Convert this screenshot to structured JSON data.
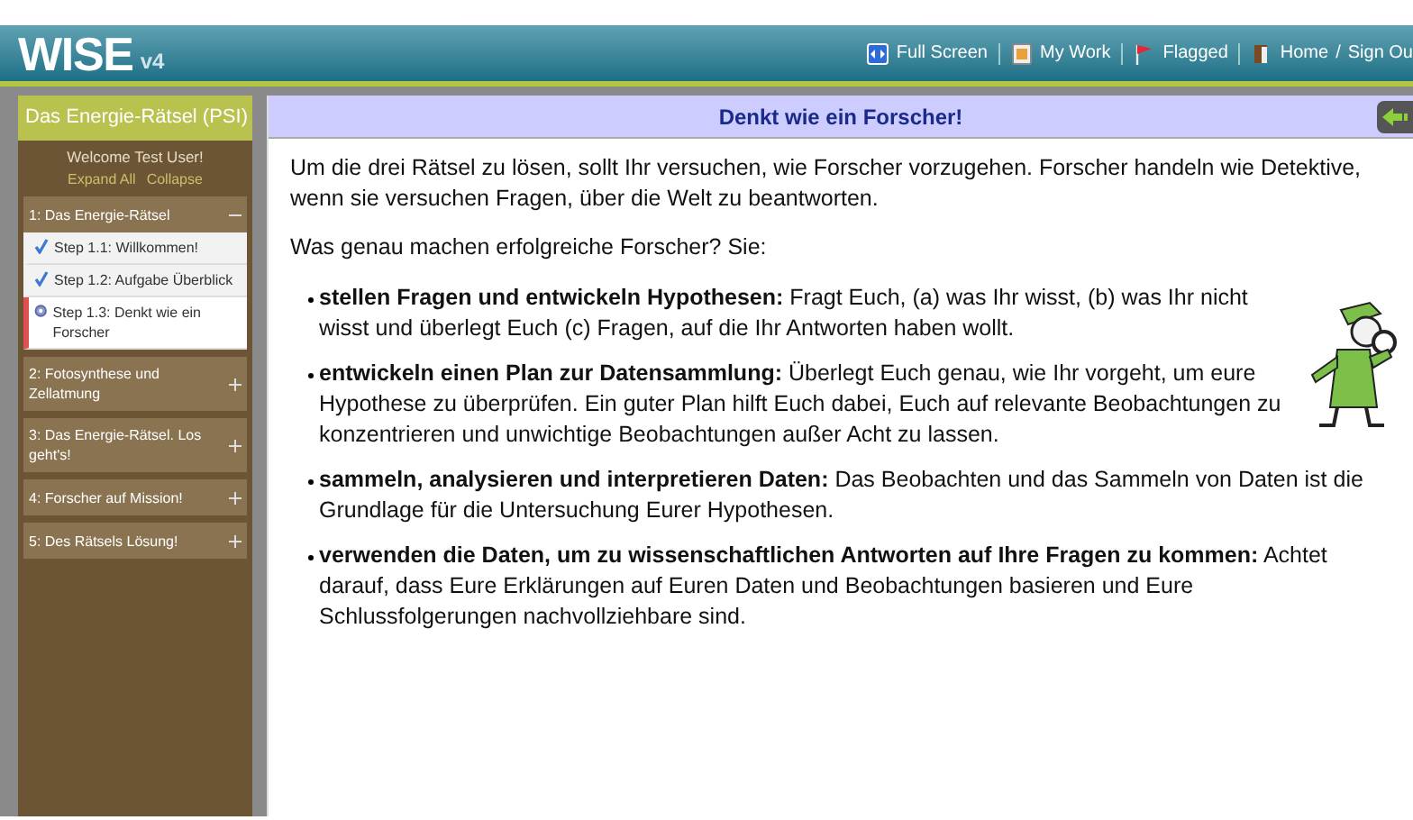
{
  "header": {
    "logo": "WISE",
    "version": "v4",
    "links": [
      {
        "label": "Full Screen",
        "kind": "fullscreen"
      },
      {
        "label": "My Work",
        "kind": "work"
      },
      {
        "label": "Flagged",
        "kind": "flag"
      },
      {
        "label": "Home",
        "kind": "home"
      },
      {
        "label": "/",
        "kind": "sep"
      },
      {
        "label": "Sign Ou",
        "kind": "plain"
      }
    ]
  },
  "sidebar": {
    "project_title": "Das Energie-Rätsel (PSI)",
    "welcome": "Welcome Test User!",
    "expand_all": "Expand All",
    "collapse": "Collapse",
    "units": [
      {
        "title": "1: Das Energie-Rätsel",
        "expanded": true,
        "steps": [
          {
            "title": "Step 1.1: Willkommen!",
            "completed": true,
            "selected": false
          },
          {
            "title": "Step 1.2: Aufgabe Überblick",
            "completed": true,
            "selected": false
          },
          {
            "title": "Step 1.3: Denkt wie ein Forscher",
            "completed": false,
            "selected": true
          }
        ]
      },
      {
        "title": "2: Fotosynthese und Zellatmung",
        "expanded": false
      },
      {
        "title": "3: Das Energie-Rätsel. Los geht's!",
        "expanded": false
      },
      {
        "title": "4: Forscher auf Mission!",
        "expanded": false
      },
      {
        "title": "5: Des Rätsels Lösung!",
        "expanded": false
      }
    ]
  },
  "content": {
    "title": "Denkt wie ein Forscher!",
    "paragraphs": [
      "Um die drei Rätsel zu lösen, sollt Ihr versuchen, wie Forscher vorzugehen. Forscher handeln wie Detektive, wenn sie versuchen Fragen, über die Welt zu beantworten.",
      "Was genau machen erfolgreiche Forscher? Sie:"
    ],
    "bullets": [
      "**stellen Fragen und entwickeln Hypothesen:** Fragt Euch, (a) was Ihr wisst, (b) was Ihr nicht wisst und überlegt Euch (c) Fragen, auf die Ihr Antworten haben wollt.",
      "**entwickeln einen Plan zur Datensammlung:** Überlegt Euch genau, wie Ihr vorgeht, um eure Hypothese zu überprüfen. Ein guter Plan hilft Euch dabei, Euch auf relevante Beobachtungen zu konzentrieren und unwichtige Beobachtungen außer Acht zu lassen.",
      "**sammeln, analysieren und interpretieren Daten:**  Das Beobachten und das Sammeln von Daten ist die Grundlage für die Untersuchung Eurer Hypothesen.",
      "**verwenden die Daten, um zu wissenschaftlichen Antworten auf Ihre Fragen zu kommen:** Achtet darauf, dass Eure Erklärungen auf Euren Daten und Beobachtungen basieren und Eure Schlussfolgerungen nachvollziehbare sind."
    ]
  }
}
